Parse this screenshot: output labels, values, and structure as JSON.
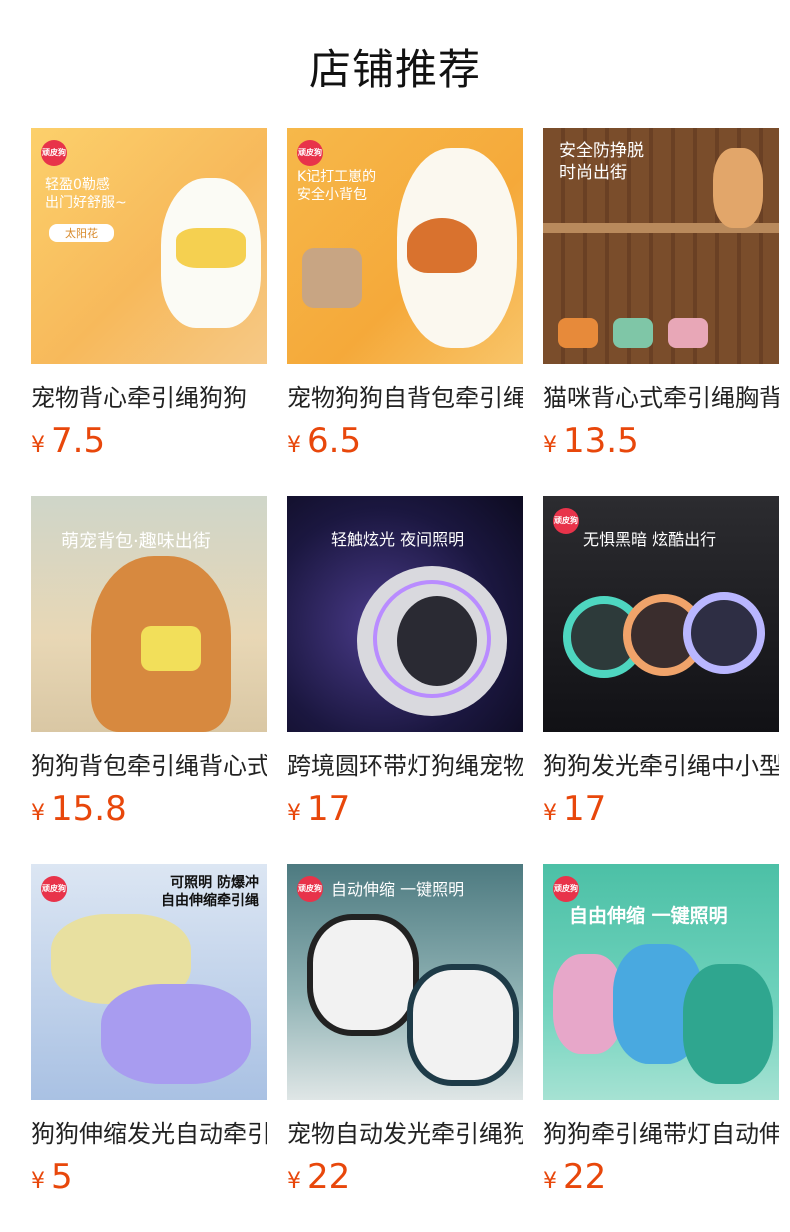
{
  "header": {
    "title": "店铺推荐"
  },
  "currency_symbol": "¥",
  "products": [
    {
      "name": "宠物背心牵引绳狗狗",
      "price": "7.5",
      "overlay": "轻盈0勒感\n出门好舒服~",
      "tag": "太阳花",
      "logo": "顽皮狗"
    },
    {
      "name": "宠物狗狗自背包牵引绳",
      "price": "6.5",
      "overlay": "K记打工崽的\n安全小背包",
      "tag": "",
      "logo": "顽皮狗"
    },
    {
      "name": "猫咪背心式牵引绳胸背",
      "price": "13.5",
      "overlay": "安全防挣脱\n时尚出街",
      "tag": "",
      "logo": ""
    },
    {
      "name": "狗狗背包牵引绳背心式",
      "price": "15.8",
      "overlay": "萌宠背包·趣味出街",
      "tag": "",
      "logo": ""
    },
    {
      "name": "跨境圆环带灯狗绳宠物",
      "price": "17",
      "overlay": "轻触炫光 夜间照明",
      "tag": "",
      "logo": ""
    },
    {
      "name": "狗狗发光牵引绳中小型",
      "price": "17",
      "overlay": "无惧黑暗 炫酷出行",
      "tag": "",
      "logo": "顽皮狗"
    },
    {
      "name": "狗狗伸缩发光自动牵引",
      "price": "5",
      "overlay": "可照明 防爆冲\n自由伸缩牵引绳",
      "tag": "",
      "logo": "顽皮狗"
    },
    {
      "name": "宠物自动发光牵引绳狗",
      "price": "22",
      "overlay": "自动伸缩 一键照明",
      "tag": "",
      "logo": "顽皮狗"
    },
    {
      "name": "狗狗牵引绳带灯自动伸",
      "price": "22",
      "overlay": "自由伸缩 一键照明",
      "tag": "",
      "logo": "顽皮狗"
    }
  ]
}
